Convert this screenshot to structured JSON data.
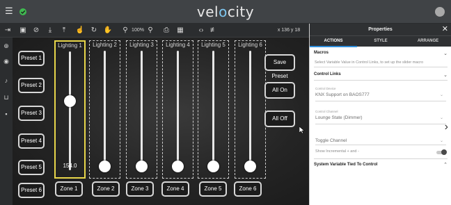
{
  "app": {
    "brand_prefix": "vel",
    "brand_accent": "o",
    "brand_suffix": "city",
    "accent_color": "#7ec7f0"
  },
  "toolbar": {
    "zoom_label": "100%",
    "coords_label": "x 136 y 18"
  },
  "canvas": {
    "preset_buttons": [
      "Preset 1",
      "Preset 2",
      "Preset 3",
      "Preset 4",
      "Preset 5",
      "Preset 6"
    ],
    "action_buttons": [
      "Save Preset",
      "All On",
      "All Off"
    ],
    "zone_buttons": [
      "Zone 1",
      "Zone 2",
      "Zone 3",
      "Zone 4",
      "Zone 5",
      "Zone 6"
    ],
    "sliders": [
      {
        "title": "Lighting 1",
        "value_label": "154.0",
        "level": 0.6,
        "selected": true
      },
      {
        "title": "Lighting 2",
        "value_label": "",
        "level": 0.0,
        "selected": false
      },
      {
        "title": "Lighting 3",
        "value_label": "",
        "level": 0.0,
        "selected": false
      },
      {
        "title": "Lighting 4",
        "value_label": "",
        "level": 0.0,
        "selected": false
      },
      {
        "title": "Lighting 5",
        "value_label": "",
        "level": 0.0,
        "selected": false
      },
      {
        "title": "Lighting 6",
        "value_label": "",
        "level": 0.0,
        "selected": false
      }
    ],
    "selection_color": "#e8d64a"
  },
  "panel": {
    "title": "Properties",
    "tabs": [
      "ACTIONS",
      "STYLE",
      "ARRANGE"
    ],
    "active_tab": "ACTIONS",
    "macros": {
      "heading": "Macros",
      "note": "Select Variable Value in Control Links, to set up the slider macro"
    },
    "control_links": {
      "heading": "Control Links",
      "device_label": "Control Device",
      "device_value": "KNX Support on BAOS777",
      "channel_label": "Control Channel",
      "channel_value": "Lounge State (Dimmer)",
      "toggle_channel": "Toggle Channel",
      "show_incremental": "Show Incremental + and -"
    },
    "system_variable": {
      "heading": "System Variable Tied To Control"
    }
  }
}
